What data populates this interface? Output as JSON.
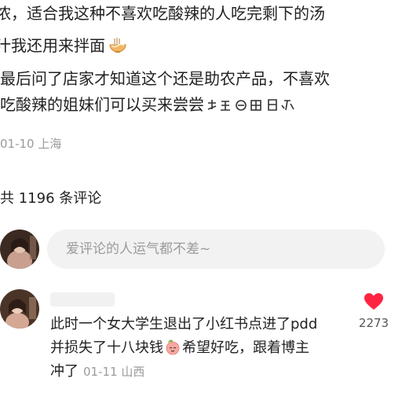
{
  "post": {
    "lines": [
      "浓，适合我这种不喜欢吃酸辣的人吃完剩下的汤",
      "汁我还用来拌面",
      "最后问了店家才知道这个还是助农产品，不喜欢",
      "吃酸辣的姐妹们可以买来尝尝"
    ],
    "emojis": [
      "noodle-bowl-emoji",
      "sticker-strip"
    ],
    "date": "01-10",
    "location": "上海"
  },
  "comments_section": {
    "count_text": "共 1196 条评论",
    "input_placeholder": "爱评论的人运气都不差~"
  },
  "comment": {
    "line1": "此时一个女大学生退出了小红书点进了pdd",
    "line2_before": "并损失了十八块钱",
    "line2_after": "希望好吃，跟着博主",
    "line3": "冲了",
    "date": "01-11",
    "location": "山西",
    "like_count": "2273",
    "liked": true,
    "emoji": "peach-face-emoji"
  },
  "colors": {
    "heart": "#ff2442",
    "meta": "#9a9a9a",
    "input_bg": "#f2f2f2"
  }
}
